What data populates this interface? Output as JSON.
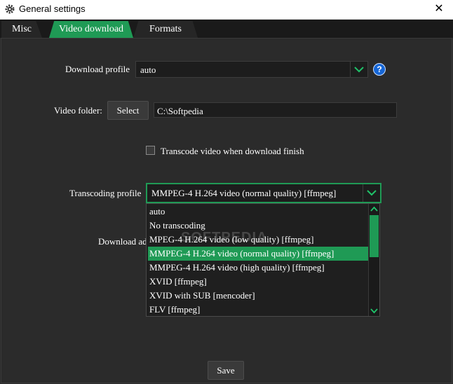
{
  "window": {
    "title": "General settings",
    "close_glyph": "✕"
  },
  "tabs": [
    {
      "label": "Misc",
      "active": false
    },
    {
      "label": "Video download",
      "active": true
    },
    {
      "label": "Formats",
      "active": false
    }
  ],
  "download_profile": {
    "label": "Download profile",
    "value": "auto",
    "help_glyph": "?"
  },
  "video_folder": {
    "label": "Video folder:",
    "select_label": "Select",
    "path": "C:\\Softpedia"
  },
  "transcode_checkbox": {
    "label": "Transcode video when download finish",
    "checked": false
  },
  "transcoding_profile": {
    "label": "Transcoding profile",
    "value": "MMPEG-4 H.264 video (normal quality) [ffmpeg]",
    "options": [
      "auto",
      "No transcoding",
      "MPEG-4 H.264 video (low quality) [ffmpeg]",
      "MMPEG-4 H.264 video (normal quality) [ffmpeg]",
      "MMPEG-4 H.264 video (high quality) [ffmpeg]",
      "XVID [ffmpeg]",
      "XVID with SUB [mencoder]",
      "FLV [ffmpeg]"
    ],
    "selected_index": 3
  },
  "hidden_label_partial": "Download ad",
  "watermark": "SOFTPEDIA",
  "save_label": "Save",
  "colors": {
    "accent": "#1f9a55",
    "background": "#2b2b2b",
    "help_icon": "#1666d6"
  }
}
